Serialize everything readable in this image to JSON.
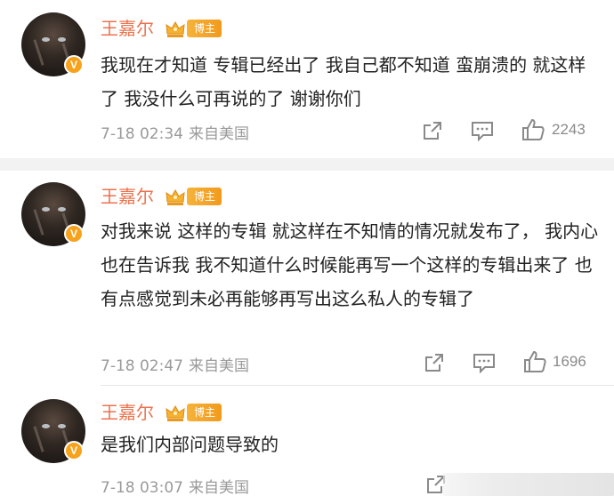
{
  "comments": [
    {
      "name": "王嘉尔",
      "tag": "博主",
      "verified": "V",
      "text": "我现在才知道 专辑已经出了 我自己都不知道 蛮崩溃的  就这样了 我没什么可再说的了  谢谢你们",
      "time": "7-18 02:34",
      "from": "来自美国",
      "likes": "2243"
    },
    {
      "name": "王嘉尔",
      "tag": "博主",
      "verified": "V",
      "text": "对我来说 这样的专辑 就这样在不知情的情况就发布了，  我内心也在告诉我 我不知道什么时候能再写一个这样的专辑出来了 也有点感觉到未必再能够再写出这么私人的专辑了",
      "time": "7-18 02:47",
      "from": "来自美国",
      "likes": "1696"
    },
    {
      "name": "王嘉尔",
      "tag": "博主",
      "verified": "V",
      "text": "是我们内部问题导致的",
      "time": "7-18 03:07",
      "from": "来自美国"
    }
  ],
  "icons": {
    "share": "share-icon",
    "comment": "comment-icon",
    "like": "thumbs-up-icon",
    "crown": "crown-icon"
  },
  "colors": {
    "name": "#eb7350",
    "tag": "#f19a1c",
    "meta": "#9a9a9a"
  }
}
